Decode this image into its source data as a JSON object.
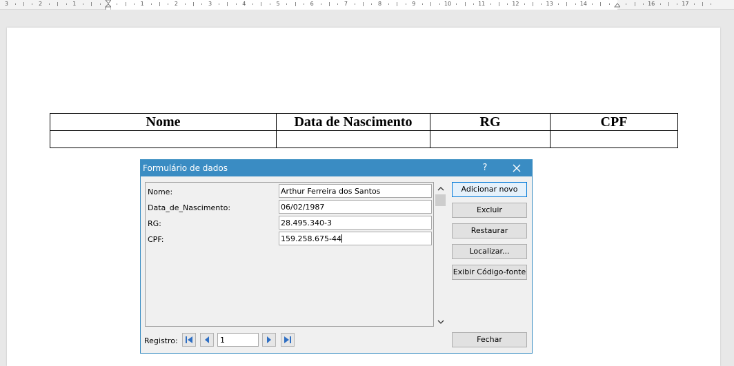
{
  "ruler": {
    "labels": [
      "3",
      "2",
      "1",
      "1",
      "2",
      "3",
      "4",
      "5",
      "6",
      "7",
      "8",
      "9",
      "10",
      "11",
      "12",
      "13",
      "14",
      "16",
      "17"
    ]
  },
  "document_table": {
    "headers": [
      "Nome",
      "Data de Nascimento",
      "RG",
      "CPF"
    ],
    "rows": [
      [
        "",
        "",
        "",
        ""
      ]
    ]
  },
  "dialog": {
    "title": "Formulário de dados",
    "help_label": "?",
    "fields": [
      {
        "label": "Nome:",
        "value": "Arthur Ferreira dos Santos"
      },
      {
        "label": "Data_de_Nascimento:",
        "value": "06/02/1987"
      },
      {
        "label": "RG:",
        "value": "28.495.340-3"
      },
      {
        "label": "CPF:",
        "value": "159.258.675-44"
      }
    ],
    "buttons": {
      "add_new": "Adicionar novo",
      "delete": "Excluir",
      "restore": "Restaurar",
      "find": "Localizar...",
      "show_source": "Exibir Código-fonte",
      "close": "Fechar"
    },
    "record_label": "Registro:",
    "record_value": "1",
    "icons": {
      "close": "close-icon",
      "scroll_up": "chevron-up-icon",
      "scroll_down": "chevron-down-icon",
      "first": "first-record-icon",
      "prev": "previous-record-icon",
      "next": "next-record-icon",
      "last": "last-record-icon"
    }
  },
  "colors": {
    "titlebar": "#3a8cc3",
    "nav_icon": "#2f6fc3",
    "default_button_border": "#0078d7"
  }
}
